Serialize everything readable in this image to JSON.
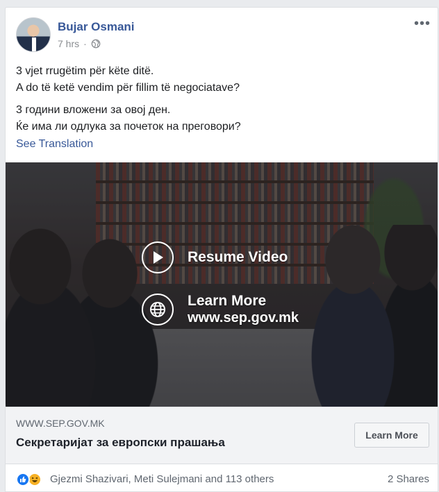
{
  "post": {
    "author": "Bujar Osmani",
    "time": "7 hrs",
    "separator": "·",
    "privacy_icon": "globe-icon",
    "more_label": "•••",
    "text_paragraphs": [
      "3 vjet rrugëtim për këte ditë.",
      "A do të ketë vendim për fillim të negociatave?",
      "3 години вложени за овој ден.",
      "Ќе има ли одлука за почеток на преговори?"
    ],
    "see_translation": "See Translation"
  },
  "video": {
    "resume_label": "Resume Video",
    "learn_more_label": "Learn More",
    "learn_more_url": "www.sep.gov.mk"
  },
  "link": {
    "domain": "WWW.SEP.GOV.MK",
    "title": "Секретаријат за европски прашања",
    "button": "Learn More"
  },
  "reactions": {
    "icons": [
      "like-icon",
      "haha-icon"
    ],
    "names": "Gjezmi Shazivari, Meti Sulejmani and 113 others",
    "shares": "2 Shares"
  },
  "colors": {
    "link_blue": "#385898",
    "like_blue": "#1877f2",
    "haha_yellow": "#f7b125",
    "page_bg": "#e9ebee"
  }
}
